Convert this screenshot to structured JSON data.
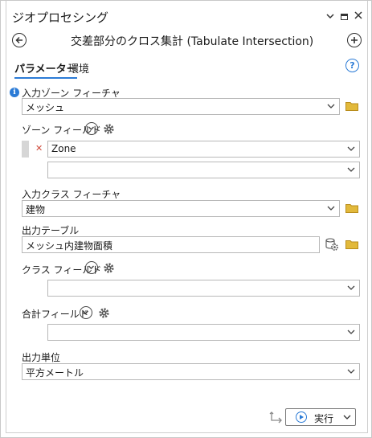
{
  "pane": {
    "title": "ジオプロセシング",
    "controls": [
      "chevron-down-icon",
      "maximize-icon",
      "close-icon"
    ]
  },
  "toolbar": {
    "back_icon": "back-arrow-icon",
    "tool_title": "交差部分のクロス集計 (Tabulate Intersection)",
    "add_icon": "add-icon"
  },
  "tabs": [
    {
      "label": "パラメーター",
      "active": true
    },
    {
      "label": "環境",
      "active": false
    }
  ],
  "params": {
    "zone_feature": {
      "label": "入力ゾーン フィーチャ",
      "value": "メッシュ"
    },
    "zone_fields": {
      "label": "ゾーン フィールド",
      "rows": [
        "Zone",
        ""
      ]
    },
    "class_feature": {
      "label": "入力クラス フィーチャ",
      "value": "建物"
    },
    "out_table": {
      "label": "出力テーブル",
      "value": "メッシュ内建物面積"
    },
    "class_fields": {
      "label": "クラス フィールド",
      "value": ""
    },
    "sum_fields": {
      "label": "合計フィールド",
      "value": ""
    },
    "out_units": {
      "label": "出力単位",
      "value": "平方メートル"
    }
  },
  "footer": {
    "run_label": "実行"
  },
  "colors": {
    "accent": "#2b7bd6",
    "folder": "#e2b93b",
    "error": "#d04a3b"
  }
}
